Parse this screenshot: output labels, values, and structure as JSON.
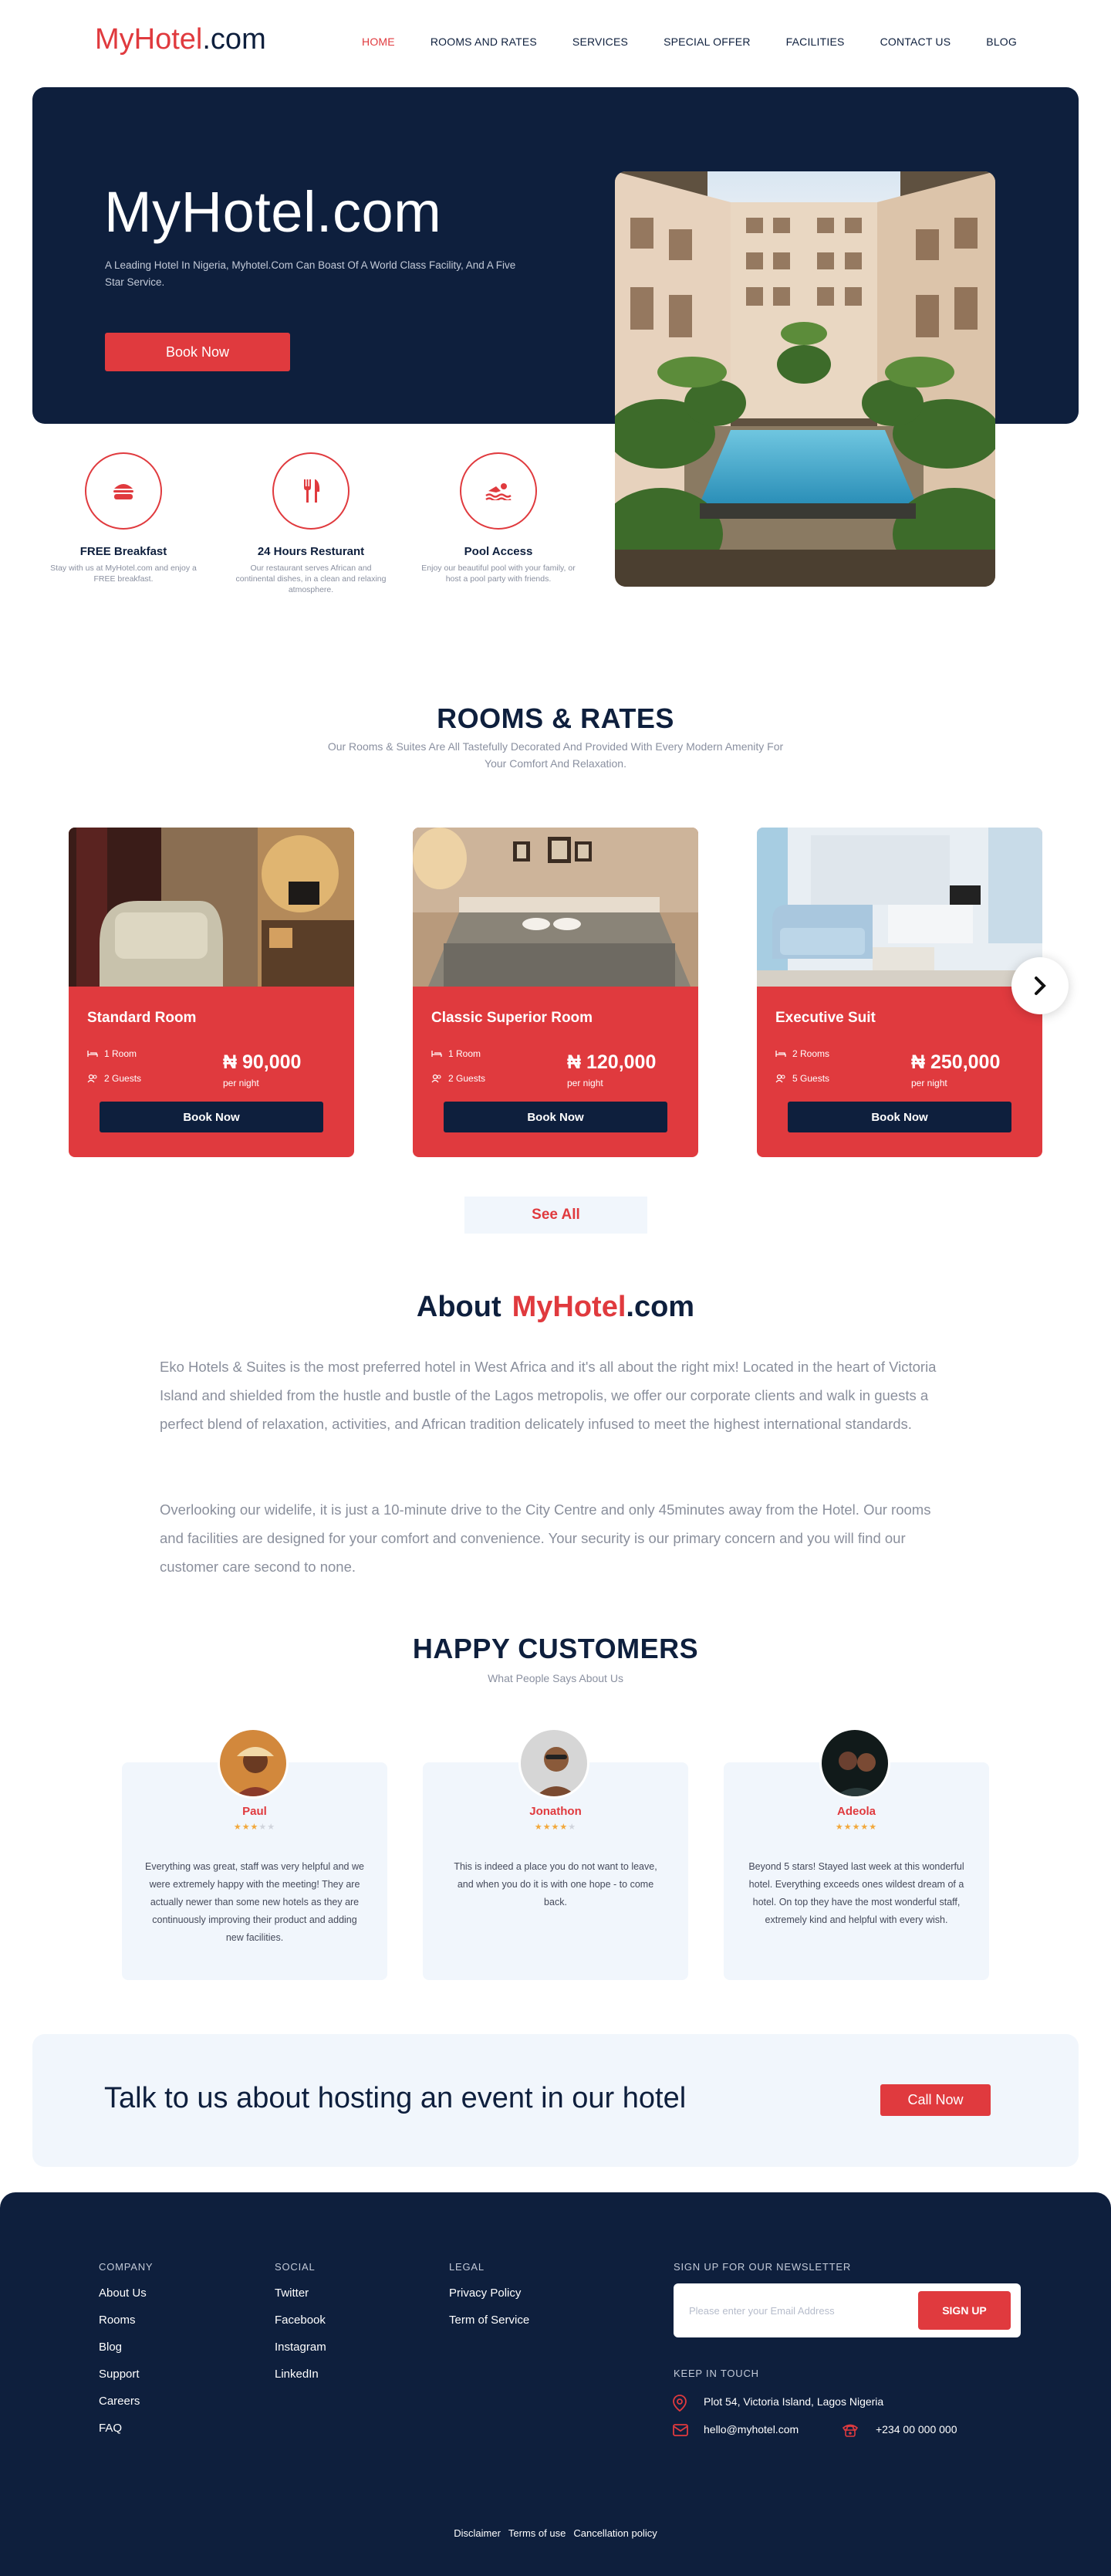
{
  "brand": {
    "part1": "MyHotel",
    "part2": ".com"
  },
  "nav": [
    "HOME",
    "ROOMS AND RATES",
    "SERVICES",
    "SPECIAL OFFER",
    "FACILITIES",
    "CONTACT US",
    "BLOG"
  ],
  "hero": {
    "title": "MyHotel.com",
    "subtitle": "A Leading Hotel In Nigeria, Myhotel.Com Can Boast Of A World Class Facility, And A Five Star Service.",
    "button": "Book Now"
  },
  "features": [
    {
      "icon": "burger-icon",
      "title": "FREE Breakfast",
      "desc": "Stay with us at MyHotel.com and enjoy a FREE breakfast."
    },
    {
      "icon": "fork-knife-icon",
      "title": "24 Hours Resturant",
      "desc": "Our restaurant serves African and continental dishes, in a clean and relaxing atmosphere."
    },
    {
      "icon": "swimmer-icon",
      "title": "Pool Access",
      "desc": "Enjoy our beautiful pool with your family, or host a pool party with friends."
    }
  ],
  "rooms_section": {
    "title": "ROOMS & RATES",
    "subtitle": "Our Rooms & Suites Are All Tastefully Decorated And Provided With Every Modern Amenity For Your Comfort And Relaxation.",
    "rooms": [
      {
        "name": "Standard Room",
        "rooms": "1 Room",
        "guests": "2 Guests",
        "price": "₦ 90,000",
        "per": "per night",
        "button": "Book Now"
      },
      {
        "name": "Classic Superior Room",
        "rooms": "1 Room",
        "guests": "2 Guests",
        "price": "₦ 120,000",
        "per": "per night",
        "button": "Book Now"
      },
      {
        "name": "Executive Suit",
        "rooms": "2 Rooms",
        "guests": "5 Guests",
        "price": "₦ 250,000",
        "per": "per night",
        "button": "Book Now"
      }
    ],
    "see_all": "See All"
  },
  "about": {
    "title_prefix": "About",
    "title_brand1": "MyHotel",
    "title_brand2": ".com",
    "paragraphs": [
      "Eko Hotels & Suites is the most preferred hotel in West Africa and it's all about the right mix! Located in the heart of Victoria Island and shielded from the hustle and bustle of the Lagos metropolis, we offer our corporate clients and walk in guests a perfect blend of relaxation, activities, and African tradition delicately infused to meet the highest international standards.",
      "Overlooking our widelife, it is just a 10-minute drive to the City Centre and only 45minutes away from the Hotel. Our rooms and facilities are designed for your comfort and convenience. Your security is our primary concern and you will find our customer care second to none."
    ]
  },
  "customers": {
    "title": "HAPPY CUSTOMERS",
    "subtitle": "What People Says About Us",
    "reviews": [
      {
        "name": "Paul",
        "rating": 3,
        "text": "Everything was great, staff was very helpful and we were extremely happy with the meeting! They are actually newer than some new hotels as they are continuously improving their product and adding new facilities."
      },
      {
        "name": "Jonathon",
        "rating": 4,
        "text": "This is indeed a place you do not want to leave, and when you do it is with one hope - to come back."
      },
      {
        "name": "Adeola",
        "rating": 5,
        "text": "Beyond 5 stars! Stayed last week at this wonderful hotel. Everything exceeds ones wildest dream of a hotel. On top they have the most wonderful staff, extremely kind and helpful with every wish."
      }
    ]
  },
  "event": {
    "text": "Talk to us about hosting an event in our hotel",
    "button": "Call Now"
  },
  "footer": {
    "company": {
      "heading": "COMPANY",
      "links": [
        "About Us",
        "Rooms",
        "Blog",
        "Support",
        "Careers",
        "FAQ"
      ]
    },
    "social": {
      "heading": "SOCIAL",
      "links": [
        "Twitter",
        "Facebook",
        "Instagram",
        "LinkedIn"
      ]
    },
    "legal": {
      "heading": "LEGAL",
      "links": [
        "Privacy Policy",
        "Term of Service"
      ]
    },
    "newsletter": {
      "heading": "SIGN UP FOR OUR NEWSLETTER",
      "placeholder": "Please enter your Email Address",
      "button": "SIGN UP"
    },
    "contact": {
      "heading": "KEEP IN TOUCH",
      "address": "Plot 54, Victoria Island, Lagos Nigeria",
      "email": "hello@myhotel.com",
      "phone": "+234 00 000 000"
    },
    "bottom_links": [
      "Disclaimer",
      "Terms of use",
      "Cancellation policy"
    ]
  },
  "colors": {
    "navy": "#0e1f3d",
    "red": "#e03a3e",
    "light": "#f1f6fc",
    "star": "#f2a83b"
  }
}
